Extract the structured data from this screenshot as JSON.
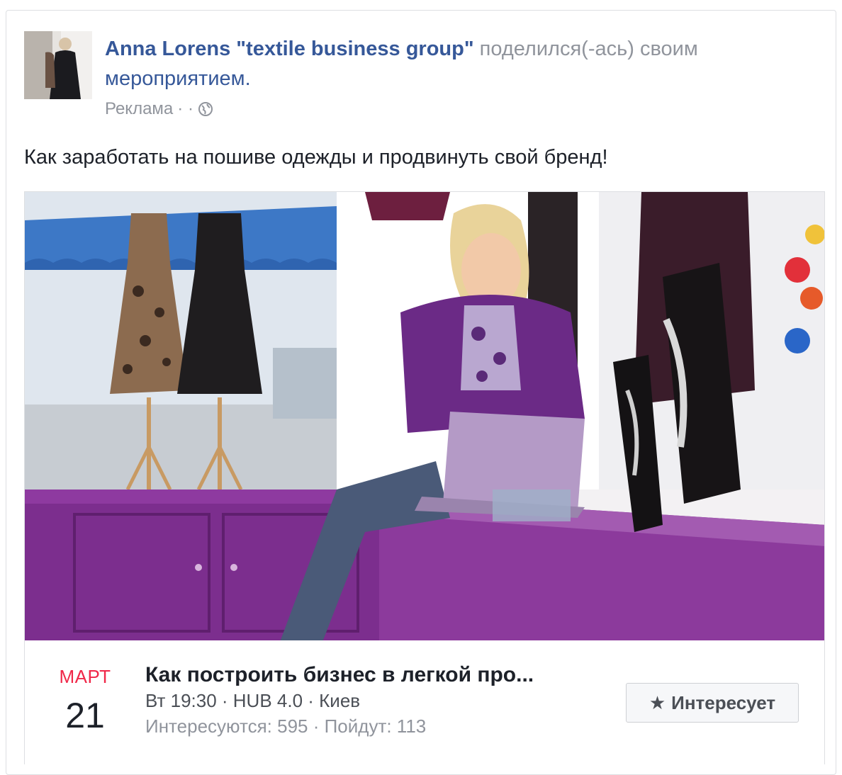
{
  "post": {
    "author": "Anna Lorens \"textile business group\"",
    "action_text": " поделился(-ась) своим ",
    "action_link": "мероприятием.",
    "sponsored_label": "Реклама",
    "sponsored_sep": "· ·",
    "text": "Как заработать на пошиве одежды и продвинуть свой бренд!"
  },
  "event": {
    "month": "МАРТ",
    "day": "21",
    "title": "Как построить бизнес в легкой про...",
    "meta": "Вт 19:30 · HUB 4.0 · Киев",
    "stats": "Интересуются: 595 · Пойдут: 113",
    "interest_label": "Интересует"
  },
  "icons": {
    "globe": "globe-icon",
    "star": "star-icon"
  },
  "colors": {
    "link": "#365899",
    "month": "#f02849",
    "secondary": "#90949c",
    "accent_purple": "#7b2a8c"
  }
}
